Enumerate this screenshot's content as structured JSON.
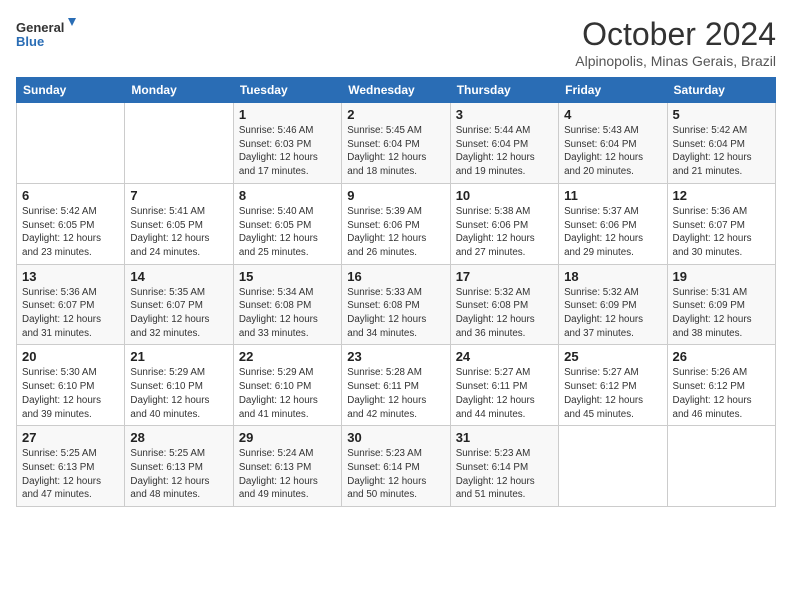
{
  "logo": {
    "line1": "General",
    "line2": "Blue"
  },
  "title": "October 2024",
  "location": "Alpinopolis, Minas Gerais, Brazil",
  "weekdays": [
    "Sunday",
    "Monday",
    "Tuesday",
    "Wednesday",
    "Thursday",
    "Friday",
    "Saturday"
  ],
  "weeks": [
    [
      {
        "day": "",
        "info": ""
      },
      {
        "day": "",
        "info": ""
      },
      {
        "day": "1",
        "info": "Sunrise: 5:46 AM\nSunset: 6:03 PM\nDaylight: 12 hours and 17 minutes."
      },
      {
        "day": "2",
        "info": "Sunrise: 5:45 AM\nSunset: 6:04 PM\nDaylight: 12 hours and 18 minutes."
      },
      {
        "day": "3",
        "info": "Sunrise: 5:44 AM\nSunset: 6:04 PM\nDaylight: 12 hours and 19 minutes."
      },
      {
        "day": "4",
        "info": "Sunrise: 5:43 AM\nSunset: 6:04 PM\nDaylight: 12 hours and 20 minutes."
      },
      {
        "day": "5",
        "info": "Sunrise: 5:42 AM\nSunset: 6:04 PM\nDaylight: 12 hours and 21 minutes."
      }
    ],
    [
      {
        "day": "6",
        "info": "Sunrise: 5:42 AM\nSunset: 6:05 PM\nDaylight: 12 hours and 23 minutes."
      },
      {
        "day": "7",
        "info": "Sunrise: 5:41 AM\nSunset: 6:05 PM\nDaylight: 12 hours and 24 minutes."
      },
      {
        "day": "8",
        "info": "Sunrise: 5:40 AM\nSunset: 6:05 PM\nDaylight: 12 hours and 25 minutes."
      },
      {
        "day": "9",
        "info": "Sunrise: 5:39 AM\nSunset: 6:06 PM\nDaylight: 12 hours and 26 minutes."
      },
      {
        "day": "10",
        "info": "Sunrise: 5:38 AM\nSunset: 6:06 PM\nDaylight: 12 hours and 27 minutes."
      },
      {
        "day": "11",
        "info": "Sunrise: 5:37 AM\nSunset: 6:06 PM\nDaylight: 12 hours and 29 minutes."
      },
      {
        "day": "12",
        "info": "Sunrise: 5:36 AM\nSunset: 6:07 PM\nDaylight: 12 hours and 30 minutes."
      }
    ],
    [
      {
        "day": "13",
        "info": "Sunrise: 5:36 AM\nSunset: 6:07 PM\nDaylight: 12 hours and 31 minutes."
      },
      {
        "day": "14",
        "info": "Sunrise: 5:35 AM\nSunset: 6:07 PM\nDaylight: 12 hours and 32 minutes."
      },
      {
        "day": "15",
        "info": "Sunrise: 5:34 AM\nSunset: 6:08 PM\nDaylight: 12 hours and 33 minutes."
      },
      {
        "day": "16",
        "info": "Sunrise: 5:33 AM\nSunset: 6:08 PM\nDaylight: 12 hours and 34 minutes."
      },
      {
        "day": "17",
        "info": "Sunrise: 5:32 AM\nSunset: 6:08 PM\nDaylight: 12 hours and 36 minutes."
      },
      {
        "day": "18",
        "info": "Sunrise: 5:32 AM\nSunset: 6:09 PM\nDaylight: 12 hours and 37 minutes."
      },
      {
        "day": "19",
        "info": "Sunrise: 5:31 AM\nSunset: 6:09 PM\nDaylight: 12 hours and 38 minutes."
      }
    ],
    [
      {
        "day": "20",
        "info": "Sunrise: 5:30 AM\nSunset: 6:10 PM\nDaylight: 12 hours and 39 minutes."
      },
      {
        "day": "21",
        "info": "Sunrise: 5:29 AM\nSunset: 6:10 PM\nDaylight: 12 hours and 40 minutes."
      },
      {
        "day": "22",
        "info": "Sunrise: 5:29 AM\nSunset: 6:10 PM\nDaylight: 12 hours and 41 minutes."
      },
      {
        "day": "23",
        "info": "Sunrise: 5:28 AM\nSunset: 6:11 PM\nDaylight: 12 hours and 42 minutes."
      },
      {
        "day": "24",
        "info": "Sunrise: 5:27 AM\nSunset: 6:11 PM\nDaylight: 12 hours and 44 minutes."
      },
      {
        "day": "25",
        "info": "Sunrise: 5:27 AM\nSunset: 6:12 PM\nDaylight: 12 hours and 45 minutes."
      },
      {
        "day": "26",
        "info": "Sunrise: 5:26 AM\nSunset: 6:12 PM\nDaylight: 12 hours and 46 minutes."
      }
    ],
    [
      {
        "day": "27",
        "info": "Sunrise: 5:25 AM\nSunset: 6:13 PM\nDaylight: 12 hours and 47 minutes."
      },
      {
        "day": "28",
        "info": "Sunrise: 5:25 AM\nSunset: 6:13 PM\nDaylight: 12 hours and 48 minutes."
      },
      {
        "day": "29",
        "info": "Sunrise: 5:24 AM\nSunset: 6:13 PM\nDaylight: 12 hours and 49 minutes."
      },
      {
        "day": "30",
        "info": "Sunrise: 5:23 AM\nSunset: 6:14 PM\nDaylight: 12 hours and 50 minutes."
      },
      {
        "day": "31",
        "info": "Sunrise: 5:23 AM\nSunset: 6:14 PM\nDaylight: 12 hours and 51 minutes."
      },
      {
        "day": "",
        "info": ""
      },
      {
        "day": "",
        "info": ""
      }
    ]
  ]
}
